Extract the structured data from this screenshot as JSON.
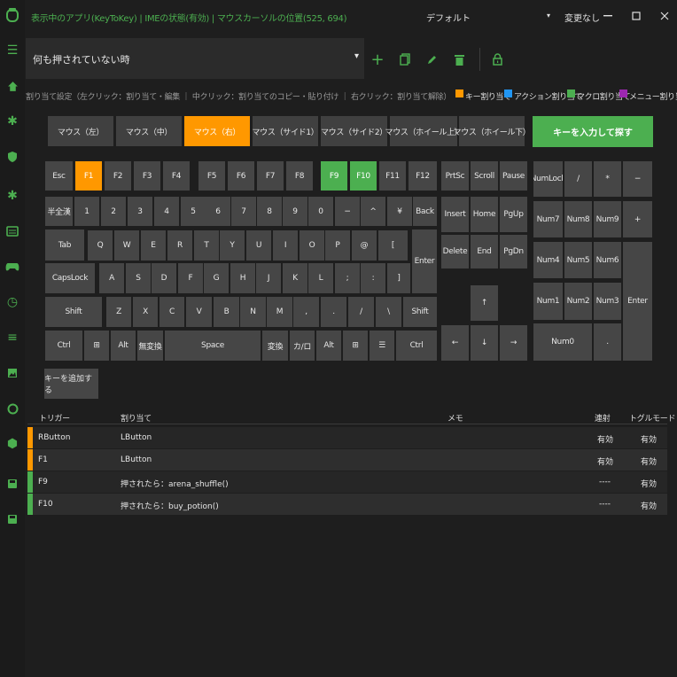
{
  "app": {
    "status": "表示中のアプリ(KeyToKey) | IMEの状態(有効) | マウスカーソルの位置(525, 694)",
    "title": "デフォルト",
    "title_caret": "▾",
    "change_status": "変更なし"
  },
  "colors": {
    "accent_green": "#4caf50",
    "key_assigned_orange": "#ff9800",
    "action_blue": "#2196f3",
    "macro_green": "#4caf50",
    "menu_purple": "#9c27b0"
  },
  "toolbar": {
    "profile": "何も押されていない時",
    "dropdown_caret": "▾",
    "add_icon": "+",
    "copy_icon": "⧉",
    "edit_icon": "✎",
    "delete_icon": "🗑",
    "lock_icon": "🔒"
  },
  "hint": "割り当て設定（左クリック：割り当て・編集 ｜ 中クリック：割り当てのコピー・貼り付け ｜ 右クリック：割り当て解除）",
  "legend": [
    {
      "label": "キー割り当て",
      "color": "#ff9800"
    },
    {
      "label": "アクション割り当て",
      "color": "#2196f3"
    },
    {
      "label": "マクロ割り当て",
      "color": "#4caf50"
    },
    {
      "label": "メニュー割り当て",
      "color": "#9c27b0"
    }
  ],
  "mouse_buttons": [
    {
      "label": "マウス（左）",
      "selected": false
    },
    {
      "label": "マウス（中）",
      "selected": false
    },
    {
      "label": "マウス（右）",
      "selected": true
    },
    {
      "label": "マウス（サイド1）",
      "selected": false
    },
    {
      "label": "マウス（サイド2）",
      "selected": false
    },
    {
      "label": "マウス（ホイール上）",
      "selected": false
    },
    {
      "label": "マウス（ホイール下）",
      "selected": false
    }
  ],
  "search_key_button": "キーを入力して探す",
  "keys": {
    "esc": "Esc",
    "f1": "F1",
    "f2": "F2",
    "f3": "F3",
    "f4": "F4",
    "f5": "F5",
    "f6": "F6",
    "f7": "F7",
    "f8": "F8",
    "f9": "F9",
    "f10": "F10",
    "f11": "F11",
    "f12": "F12",
    "prtsc": "PrtSc",
    "scroll": "Scroll",
    "pause": "Pause",
    "hankaku": "半全漢",
    "n1": "1",
    "n2": "2",
    "n3": "3",
    "n4": "4",
    "n5": "5",
    "n6": "6",
    "n7": "7",
    "n8": "8",
    "n9": "9",
    "n0": "0",
    "minus": "−",
    "caret": "^",
    "yen": "¥",
    "backspace": "Back",
    "insert": "Insert",
    "home": "Home",
    "pgup": "PgUp",
    "tab": "Tab",
    "q": "Q",
    "w": "W",
    "e": "E",
    "r": "R",
    "t": "T",
    "y": "Y",
    "u": "U",
    "i": "I",
    "o": "O",
    "p": "P",
    "at": "@",
    "lbracket": "[",
    "enter": "Enter",
    "delete": "Delete",
    "end": "End",
    "pgdn": "PgDn",
    "capslock": "CapsLock",
    "a": "A",
    "s": "S",
    "d": "D",
    "f": "F",
    "g": "G",
    "h": "H",
    "j": "J",
    "k": "K",
    "l": "L",
    "semicolon": ";",
    "colon": ":",
    "rbracket": "]",
    "shift_l": "Shift",
    "z": "Z",
    "x": "X",
    "c": "C",
    "v": "V",
    "b": "B",
    "n": "N",
    "m": "M",
    "comma": ",",
    "period": ".",
    "slash": "/",
    "backslash": "\\",
    "shift_r": "Shift",
    "up": "↑",
    "left": "←",
    "down": "↓",
    "right": "→",
    "ctrl_l": "Ctrl",
    "win_l": "⊞",
    "alt_l": "Alt",
    "muhenkan": "無変換",
    "space": "Space",
    "henkan": "変換",
    "kana": "カ/ロ",
    "alt_r": "Alt",
    "win_r": "⊞",
    "menu": "☰",
    "ctrl_r": "Ctrl",
    "numlock": "NumLock",
    "num_div": "/",
    "num_mul": "*",
    "num_sub": "−",
    "num7": "Num7",
    "num8": "Num8",
    "num9": "Num9",
    "num_add": "+",
    "num4": "Num4",
    "num5": "Num5",
    "num6": "Num6",
    "num1": "Num1",
    "num2": "Num2",
    "num3": "Num3",
    "num_enter": "Enter",
    "num0": "Num0",
    "num_dot": "."
  },
  "add_key_button": "キーを追加する",
  "table": {
    "headers": {
      "trigger": "トリガー",
      "assign": "割り当て",
      "memo": "メモ",
      "rapid": "連射",
      "toggle": "トグルモード"
    },
    "rows": [
      {
        "trigger": "RButton",
        "assign": "LButton",
        "memo": "",
        "rapid": "有効",
        "toggle": "有効",
        "color": "#ff9800"
      },
      {
        "trigger": "F1",
        "assign": "LButton",
        "memo": "",
        "rapid": "有効",
        "toggle": "有効",
        "color": "#ff9800"
      },
      {
        "trigger": "F9",
        "assign": "押されたら：arena_shuffle()",
        "memo": "",
        "rapid": "----",
        "toggle": "有効",
        "color": "#4caf50"
      },
      {
        "trigger": "F10",
        "assign": "押されたら：buy_potion()",
        "memo": "",
        "rapid": "----",
        "toggle": "有効",
        "color": "#4caf50"
      }
    ]
  }
}
